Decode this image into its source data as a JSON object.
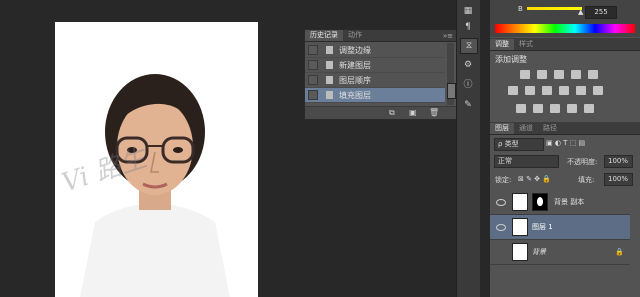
{
  "history_panel": {
    "tabs": [
      "历史记录",
      "动作"
    ],
    "items": [
      {
        "label": "调整边缘"
      },
      {
        "label": "新建图层"
      },
      {
        "label": "图层顺序"
      },
      {
        "label": "填充图层",
        "selected": true
      }
    ]
  },
  "color_panel": {
    "channel_label": "B",
    "channel_value": "255",
    "slider_color": "#ffff00"
  },
  "adjust_panel": {
    "tabs": [
      "调整",
      "样式"
    ],
    "title": "添加调整"
  },
  "layers_panel": {
    "tabs": [
      "图层",
      "通道",
      "路径"
    ],
    "filter_kind": "ρ 类型",
    "blend_mode": "正常",
    "opacity_label": "不透明度:",
    "opacity_value": "100%",
    "lock_label": "锁定:",
    "fill_label": "填充:",
    "fill_value": "100%",
    "layers": [
      {
        "name": "背景 副本",
        "has_mask": true
      },
      {
        "name": "图层 1",
        "selected": true
      },
      {
        "name": "背景",
        "locked": true
      }
    ]
  },
  "watermark_text": "Vi    路生",
  "colors": {
    "selection": "#6b7f9a",
    "layer_selection": "#5d6d85",
    "panel_bg": "#535353",
    "canvas_bg": "#282828"
  }
}
